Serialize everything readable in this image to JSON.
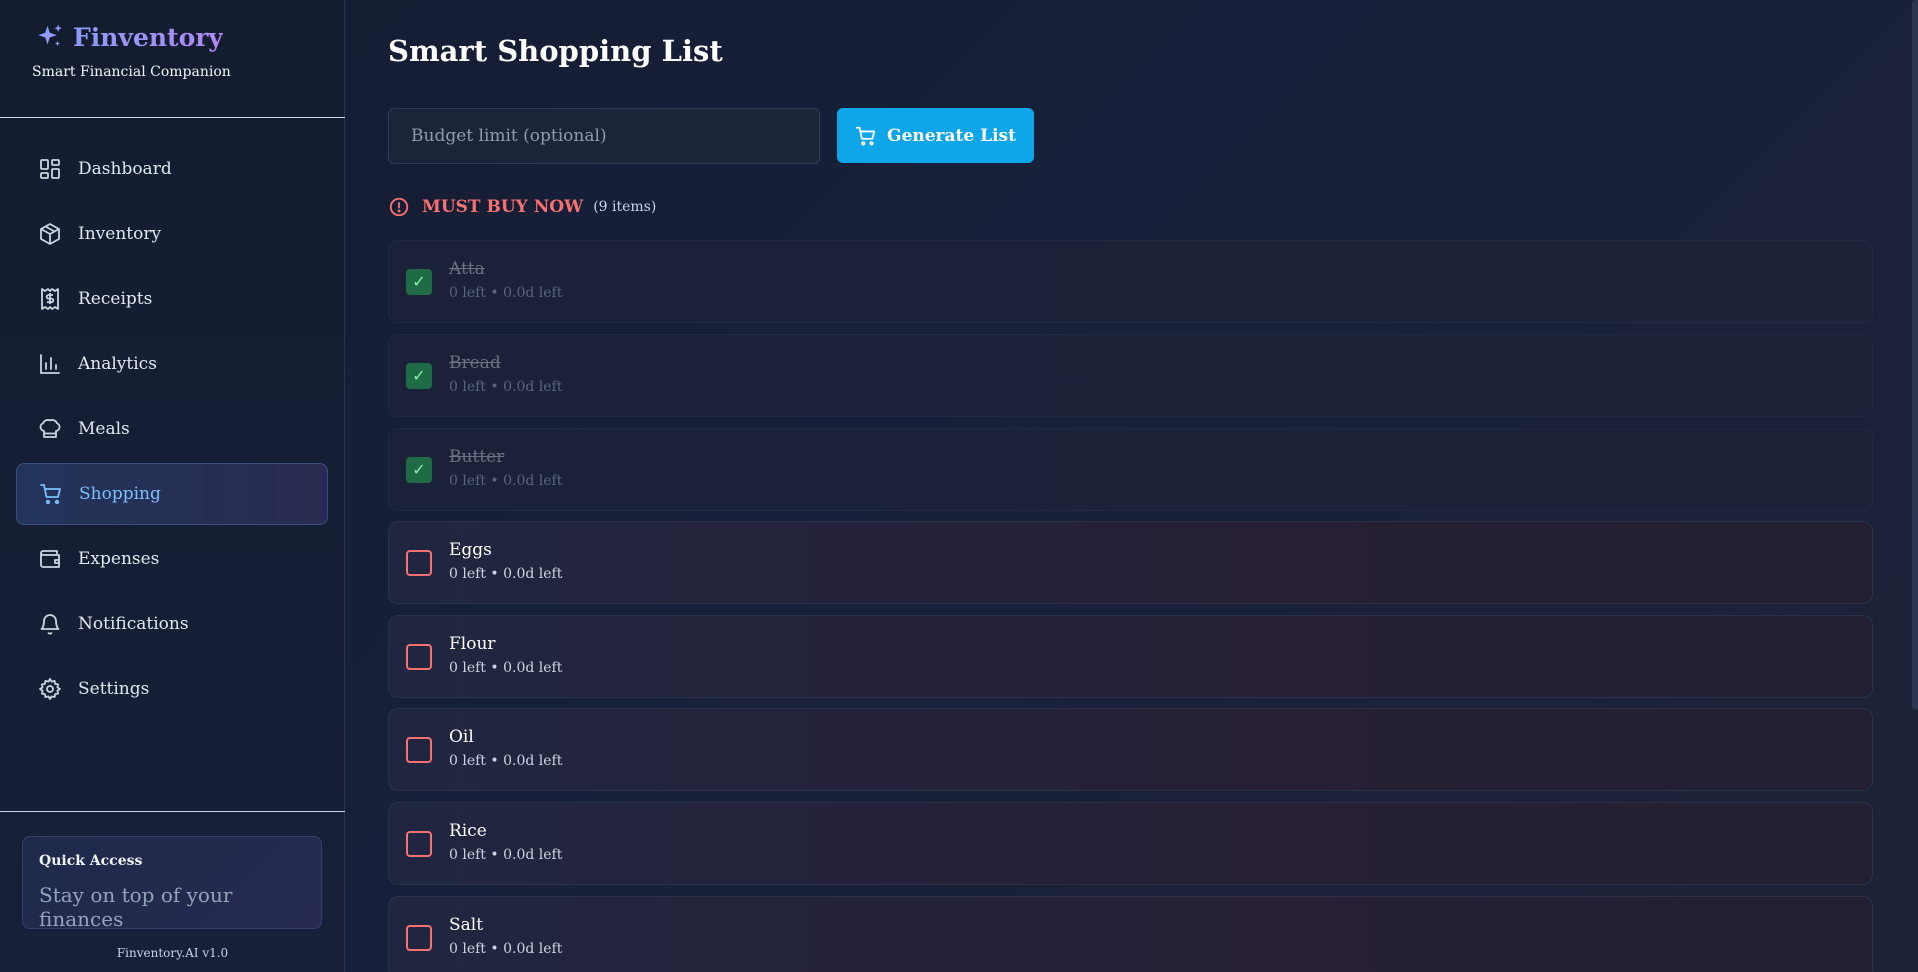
{
  "brand": {
    "name": "Finventory",
    "tagline": "Smart Financial Companion",
    "icon": "sparkles-icon"
  },
  "sidebar": {
    "items": [
      {
        "label": "Dashboard",
        "icon": "dashboard-icon",
        "active": false
      },
      {
        "label": "Inventory",
        "icon": "box-icon",
        "active": false
      },
      {
        "label": "Receipts",
        "icon": "receipt-icon",
        "active": false
      },
      {
        "label": "Analytics",
        "icon": "bar-chart-icon",
        "active": false
      },
      {
        "label": "Meals",
        "icon": "chef-hat-icon",
        "active": false
      },
      {
        "label": "Shopping",
        "icon": "cart-icon",
        "active": true
      },
      {
        "label": "Expenses",
        "icon": "wallet-icon",
        "active": false
      },
      {
        "label": "Notifications",
        "icon": "bell-icon",
        "active": false
      },
      {
        "label": "Settings",
        "icon": "gear-icon",
        "active": false
      }
    ],
    "quick_access": {
      "title": "Quick Access",
      "subtitle": "Stay on top of your finances"
    },
    "version": "Finventory.AI v1.0"
  },
  "main": {
    "title": "Smart Shopping List",
    "budget_placeholder": "Budget limit (optional)",
    "budget_value": "",
    "generate_label": "Generate List",
    "section": {
      "title": "MUST BUY NOW",
      "count": "(9 items)",
      "icon": "alert-circle-icon"
    },
    "items": [
      {
        "name": "Atta",
        "meta": "0 left • 0.0d left",
        "checked": true
      },
      {
        "name": "Bread",
        "meta": "0 left • 0.0d left",
        "checked": true
      },
      {
        "name": "Butter",
        "meta": "0 left • 0.0d left",
        "checked": true
      },
      {
        "name": "Eggs",
        "meta": "0 left • 0.0d left",
        "checked": false
      },
      {
        "name": "Flour",
        "meta": "0 left • 0.0d left",
        "checked": false
      },
      {
        "name": "Oil",
        "meta": "0 left • 0.0d left",
        "checked": false
      },
      {
        "name": "Rice",
        "meta": "0 left • 0.0d left",
        "checked": false
      },
      {
        "name": "Salt",
        "meta": "0 left • 0.0d left",
        "checked": false
      }
    ]
  },
  "colors": {
    "accent": "#0ea5e9",
    "danger": "#f87171",
    "active_nav_text": "#7cc0ff",
    "checked": "#1f6b45"
  }
}
